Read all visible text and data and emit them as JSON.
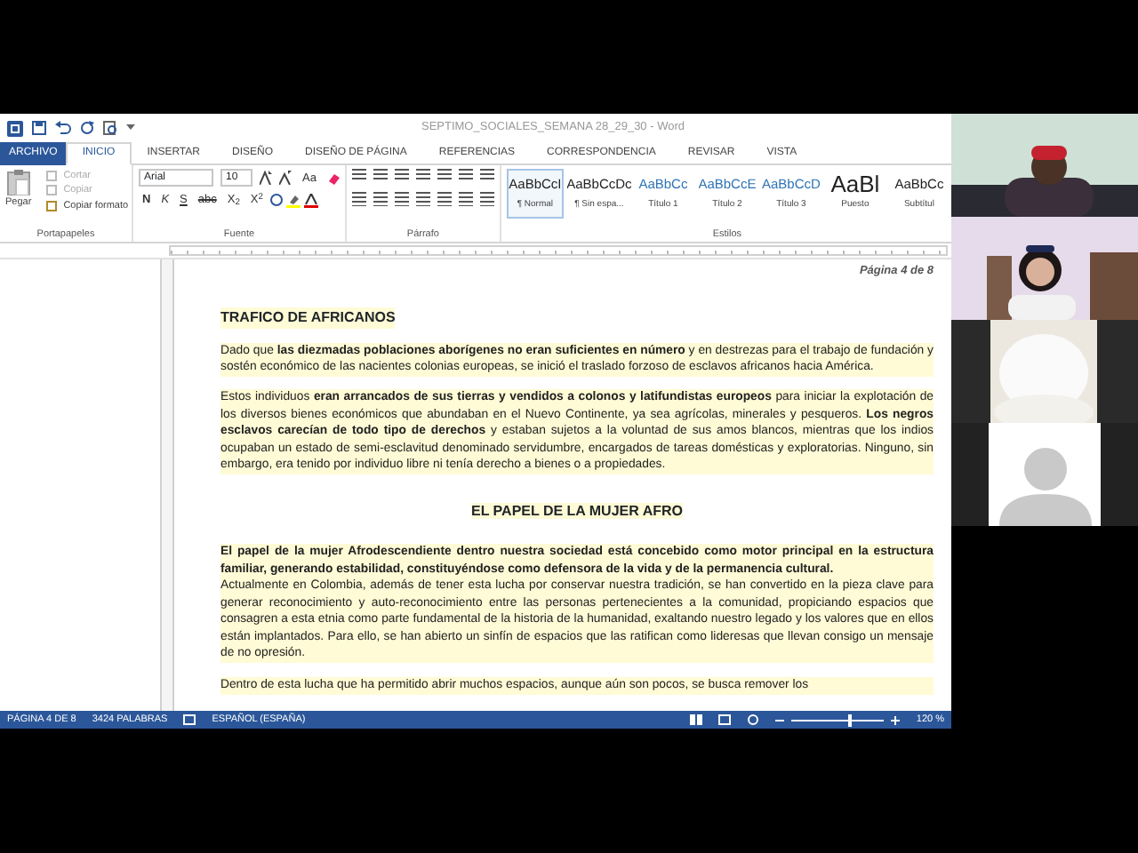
{
  "window": {
    "title": "SEPTIMO_SOCIALES_SEMANA 28_29_30 - Word"
  },
  "tabs": [
    {
      "label": "ARCHIVO",
      "kind": "file",
      "selected": false
    },
    {
      "label": "INICIO",
      "kind": "tab",
      "selected": true
    },
    {
      "label": "INSERTAR",
      "kind": "tab",
      "selected": false
    },
    {
      "label": "DISEÑO",
      "kind": "tab",
      "selected": false
    },
    {
      "label": "DISEÑO DE PÁGINA",
      "kind": "tab",
      "selected": false
    },
    {
      "label": "REFERENCIAS",
      "kind": "tab",
      "selected": false
    },
    {
      "label": "CORRESPONDENCIA",
      "kind": "tab",
      "selected": false
    },
    {
      "label": "REVISAR",
      "kind": "tab",
      "selected": false
    },
    {
      "label": "VISTA",
      "kind": "tab",
      "selected": false
    }
  ],
  "clipboard": {
    "label": "Portapapeles",
    "paste": "Pegar",
    "items": [
      {
        "label": "Cortar",
        "disabled": true
      },
      {
        "label": "Copiar",
        "disabled": true
      },
      {
        "label": "Copiar formato",
        "disabled": false
      }
    ]
  },
  "font": {
    "label": "Fuente",
    "family": "Arial",
    "size": "10",
    "case_button": "Aa",
    "format_buttons": [
      "N",
      "K",
      "S",
      "abc",
      "X$_{2}$",
      "X$^{2}$"
    ]
  },
  "paragraph": {
    "label": "Párrafo"
  },
  "styles": {
    "label": "Estilos",
    "items": [
      {
        "preview": "AaBbCcI",
        "name": "¶ Normal",
        "selected": true
      },
      {
        "preview": "AaBbCcDc",
        "name": "¶ Sin espa...",
        "selected": false
      },
      {
        "preview": "AaBbCc",
        "name": "Título 1",
        "selected": false
      },
      {
        "preview": "AaBbCcE",
        "name": "Título 2",
        "selected": false
      },
      {
        "preview": "AaBbCcD",
        "name": "Título 3",
        "selected": false
      },
      {
        "preview": "AaBl",
        "name": "Puesto",
        "selected": false
      },
      {
        "preview": "AaBbCc",
        "name": "Subtítul",
        "selected": false
      }
    ]
  },
  "document": {
    "page_header": "Página 4 de 8",
    "blocks": [
      {
        "kind": "heading",
        "text": "TRAFICO DE AFRICANOS"
      },
      {
        "kind": "paragraph",
        "text": "Dado que **las diezmadas poblaciones aborígenes no eran suficientes en número** y en destrezas para el trabajo de fundación y sostén económico de las nacientes colonias europeas, se inició el traslado forzoso de esclavos africanos hacia América."
      },
      {
        "kind": "paragraph",
        "text": "Estos individuos **eran arrancados de sus tierras y vendidos a colonos y latifundistas europeos** para iniciar la explotación de los diversos bienes económicos que abundaban en el Nuevo Continente, ya sea agrícolas, minerales y pesqueros. **Los negros esclavos carecían de todo tipo de derechos** y estaban sujetos a la voluntad de sus amos blancos, mientras que los indios ocupaban un estado de semi-esclavitud denominado servidumbre, encargados de tareas domésticas y exploratorias. Ninguno, sin embargo, era tenido por individuo libre ni tenía derecho a bienes o a propiedades."
      },
      {
        "kind": "centered_heading",
        "text": "EL PAPEL DE LA MUJER AFRO"
      },
      {
        "kind": "bold_paragraph",
        "text": "El papel de la mujer Afrodescendiente dentro nuestra sociedad está concebido como motor principal en la estructura familiar, generando estabilidad, constituyéndose como defensora de la vida y de la permanencia cultural."
      },
      {
        "kind": "paragraph_tight",
        "text": "Actualmente en Colombia, además de tener esta lucha por conservar nuestra tradición, se han convertido en la pieza clave para generar reconocimiento y auto-reconocimiento entre las personas pertenecientes a la comunidad, propiciando espacios que consagren a esta etnia como parte fundamental de la historia de la humanidad, exaltando nuestro legado y los valores que en ellos están implantados. Para ello, se han abierto un sinfín de espacios que las ratifican como lideresas que llevan consigo un mensaje de no opresión."
      },
      {
        "kind": "paragraph",
        "text": "Dentro de esta lucha que ha permitido abrir muchos espacios, aunque aún son pocos, se busca remover los"
      }
    ]
  },
  "status_bar": {
    "page": "PÁGINA 4 DE 8",
    "words": "3424 PALABRAS",
    "language": "ESPAÑOL (ESPAÑA)",
    "zoom": "120 %",
    "level": 0.6
  },
  "participants": [
    {
      "kind": "camera"
    },
    {
      "kind": "camera"
    },
    {
      "kind": "camera"
    },
    {
      "kind": "avatar"
    }
  ]
}
